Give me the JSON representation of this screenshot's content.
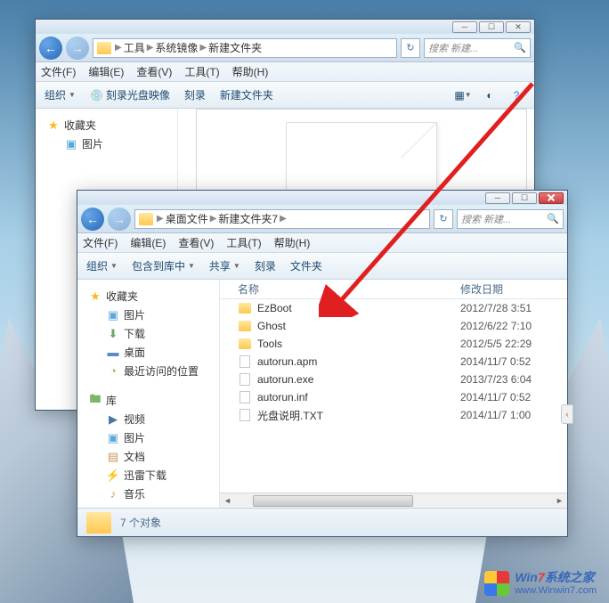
{
  "window1": {
    "breadcrumb": [
      "工具",
      "系统镜像",
      "新建文件夹"
    ],
    "search_placeholder": "搜索 新建...",
    "menus": {
      "file": "文件(F)",
      "edit": "编辑(E)",
      "view": "查看(V)",
      "tools": "工具(T)",
      "help": "帮助(H)"
    },
    "toolbar": {
      "organize": "组织",
      "burn_image": "刻录光盘映像",
      "burn": "刻录",
      "new_folder": "新建文件夹"
    },
    "sidebar": {
      "favorites": "收藏夹",
      "pictures": "图片"
    }
  },
  "window2": {
    "breadcrumb": [
      "桌面文件",
      "新建文件夹7"
    ],
    "search_placeholder": "搜索 新建...",
    "menus": {
      "file": "文件(F)",
      "edit": "编辑(E)",
      "view": "查看(V)",
      "tools": "工具(T)",
      "help": "帮助(H)"
    },
    "toolbar": {
      "organize": "组织",
      "include": "包含到库中",
      "share": "共享",
      "burn": "刻录",
      "new_folder": "文件夹"
    },
    "sidebar": {
      "favorites": "收藏夹",
      "pictures": "图片",
      "downloads": "下载",
      "desktop": "桌面",
      "recent": "最近访问的位置",
      "libraries": "库",
      "videos": "视频",
      "pictures2": "图片",
      "documents": "文档",
      "thunder": "迅雷下载",
      "music": "音乐"
    },
    "columns": {
      "name": "名称",
      "date": "修改日期"
    },
    "files": [
      {
        "name": "EzBoot",
        "type": "folder",
        "date": "2012/7/28 3:51"
      },
      {
        "name": "Ghost",
        "type": "folder",
        "date": "2012/6/22 7:10"
      },
      {
        "name": "Tools",
        "type": "folder",
        "date": "2012/5/5 22:29"
      },
      {
        "name": "autorun.apm",
        "type": "file",
        "date": "2014/11/7 0:52"
      },
      {
        "name": "autorun.exe",
        "type": "file",
        "date": "2013/7/23 6:04"
      },
      {
        "name": "autorun.inf",
        "type": "file",
        "date": "2014/11/7 0:52"
      },
      {
        "name": "光盘说明.TXT",
        "type": "file",
        "date": "2014/11/7 1:00"
      }
    ],
    "status": "7 个对象"
  },
  "watermark": {
    "brand_pre": "Win",
    "brand_num": "7",
    "brand_post": "系统之家",
    "url": "www.Winwin7.com"
  }
}
